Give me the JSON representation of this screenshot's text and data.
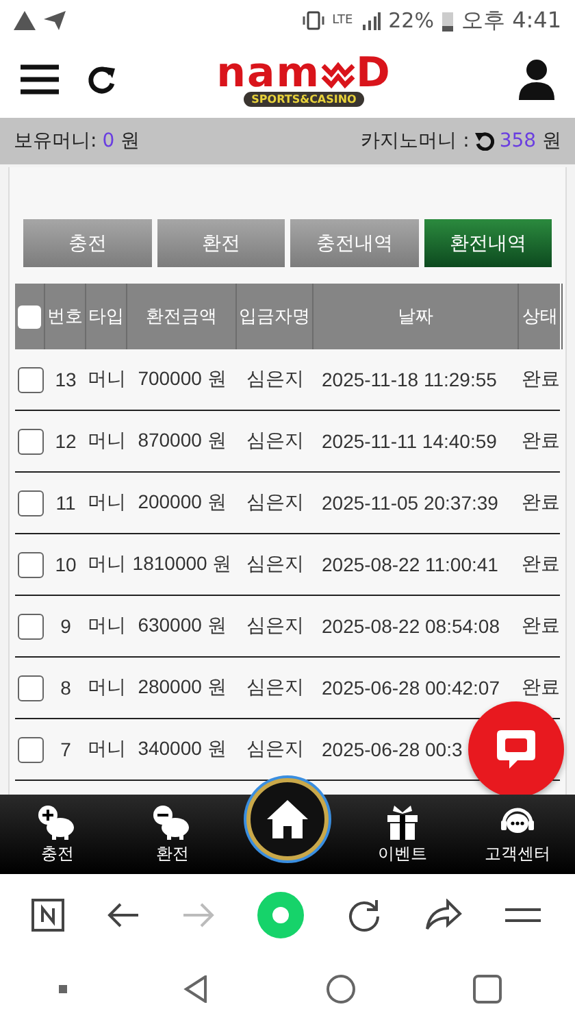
{
  "status_bar": {
    "network": "LTE",
    "battery": "22%",
    "time": "오후 4:41"
  },
  "header": {
    "logo": {
      "left": "nam",
      "right": "D",
      "tagline": "SPORTS&CASINO"
    }
  },
  "balance_bar": {
    "holding_label": "보유머니:",
    "holding_value": "0",
    "holding_unit": "원",
    "casino_label": "카지노머니 :",
    "casino_value": "358",
    "casino_unit": "원"
  },
  "tabs": [
    {
      "label": "충전",
      "selected": false
    },
    {
      "label": "환전",
      "selected": false
    },
    {
      "label": "충전내역",
      "selected": false
    },
    {
      "label": "환전내역",
      "selected": true
    }
  ],
  "table": {
    "header_checked": false,
    "columns": [
      "번호",
      "타입",
      "환전금액",
      "입금자명",
      "날짜",
      "상태"
    ],
    "rows": [
      {
        "checked": false,
        "cells": [
          "13",
          "머니",
          "700000 원",
          "심은지",
          "2025-11-18 11:29:55",
          "완료"
        ]
      },
      {
        "checked": false,
        "cells": [
          "12",
          "머니",
          "870000 원",
          "심은지",
          "2025-11-11 14:40:59",
          "완료"
        ]
      },
      {
        "checked": false,
        "cells": [
          "11",
          "머니",
          "200000 원",
          "심은지",
          "2025-11-05 20:37:39",
          "완료"
        ]
      },
      {
        "checked": false,
        "cells": [
          "10",
          "머니",
          "1810000 원",
          "심은지",
          "2025-08-22 11:00:41",
          "완료"
        ]
      },
      {
        "checked": false,
        "cells": [
          "9",
          "머니",
          "630000 원",
          "심은지",
          "2025-08-22 08:54:08",
          "완료"
        ]
      },
      {
        "checked": false,
        "cells": [
          "8",
          "머니",
          "280000 원",
          "심은지",
          "2025-06-28 00:42:07",
          "완료"
        ]
      },
      {
        "checked": false,
        "cells": [
          "7",
          "머니",
          "340000 원",
          "심은지",
          "2025-06-28 00:3"
        ]
      }
    ]
  },
  "bottom_nav": [
    {
      "kind": "deposit",
      "label": "충전"
    },
    {
      "kind": "withdraw",
      "label": "환전"
    },
    {
      "kind": "home"
    },
    {
      "kind": "gift",
      "label": "이벤트"
    },
    {
      "kind": "support",
      "label": "고객센터"
    }
  ]
}
